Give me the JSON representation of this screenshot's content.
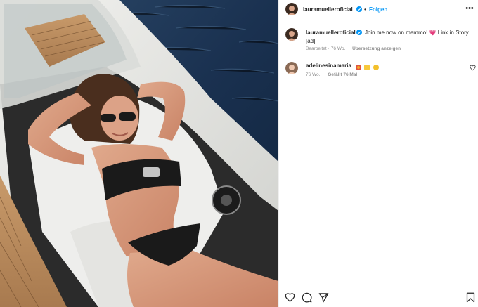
{
  "post": {
    "username": "lauramuelleroficial",
    "follow_label": "Folgen",
    "separator": "•",
    "more_label": "•••",
    "image_alt": "Woman in black bikini sunbathing on a boat"
  },
  "caption": {
    "username": "lauramuelleroficial",
    "text": "Join me now on memmo!",
    "emoji": "💗",
    "text_after": "Link in Story [ad]",
    "edited_label": "Bearbeitet",
    "age": "76 Wo.",
    "translate_label": "Übersetzung anzeigen"
  },
  "comment": {
    "username": "adelinesinamaria",
    "emoji_icons": [
      "heart-eyes-emoji",
      "yellow-heart-emoji",
      "sun-emoji"
    ],
    "age": "76 Wo.",
    "likes": "Gefällt 76 Mal"
  },
  "colors": {
    "accent": "#0095f6",
    "verified": "#0095f6",
    "muted": "#8e8e8e",
    "text": "#262626",
    "divider": "#efefef"
  },
  "icons": {
    "like": "heart-outline-icon",
    "comment": "speech-bubble-icon",
    "share": "paper-plane-icon",
    "save": "bookmark-icon",
    "more": "ellipsis-icon",
    "verified": "verified-badge-icon"
  }
}
